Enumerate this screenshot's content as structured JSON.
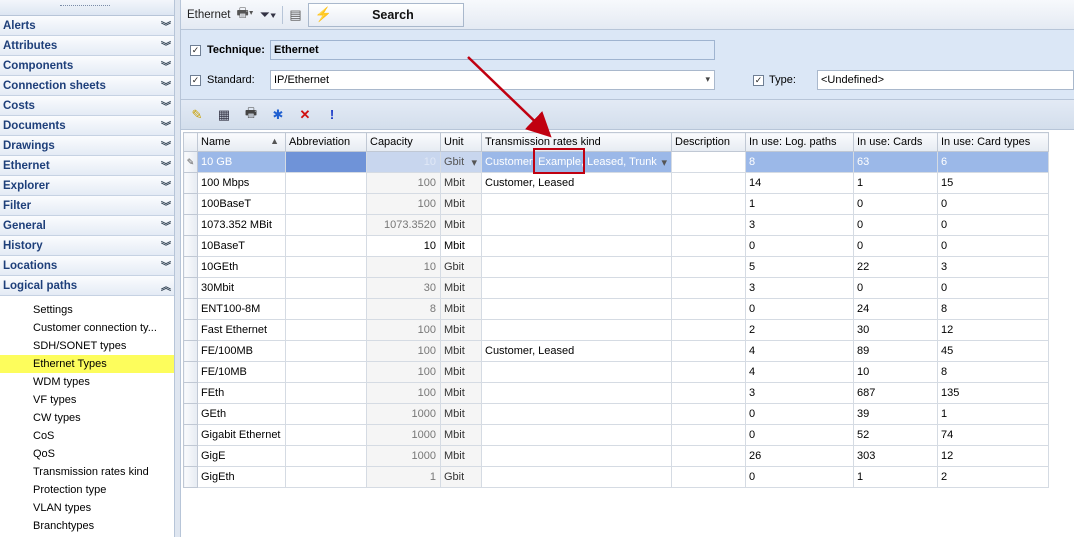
{
  "sidebar": {
    "sections": [
      {
        "label": "Alerts"
      },
      {
        "label": "Attributes"
      },
      {
        "label": "Components"
      },
      {
        "label": "Connection sheets"
      },
      {
        "label": "Costs"
      },
      {
        "label": "Documents"
      },
      {
        "label": "Drawings"
      },
      {
        "label": "Ethernet"
      },
      {
        "label": "Explorer"
      },
      {
        "label": "Filter"
      },
      {
        "label": "General"
      },
      {
        "label": "History"
      },
      {
        "label": "Locations"
      },
      {
        "label": "Logical paths"
      }
    ],
    "expanded_section": "Logical paths",
    "items": [
      {
        "label": "Settings"
      },
      {
        "label": "Customer connection ty..."
      },
      {
        "label": "SDH/SONET types"
      },
      {
        "label": "Ethernet Types"
      },
      {
        "label": "WDM types"
      },
      {
        "label": "VF types"
      },
      {
        "label": "CW types"
      },
      {
        "label": "CoS"
      },
      {
        "label": "QoS"
      },
      {
        "label": "Transmission rates kind"
      },
      {
        "label": "Protection type"
      },
      {
        "label": "VLAN types"
      },
      {
        "label": "Branchtypes"
      }
    ],
    "selected_item": "Ethernet Types"
  },
  "toolbar": {
    "tab_label": "Ethernet",
    "search_label": "Search"
  },
  "filters": {
    "technique_label": "Technique:",
    "technique_value": "Ethernet",
    "standard_label": "Standard:",
    "standard_value": "IP/Ethernet",
    "type_label": "Type:",
    "type_value": "<Undefined>"
  },
  "grid": {
    "columns": [
      "Name",
      "Abbreviation",
      "Capacity",
      "Unit",
      "Transmission rates kind",
      "Description",
      "In use: Log. paths",
      "In use: Cards",
      "In use: Card types"
    ],
    "rows": [
      {
        "name": "10 GB",
        "abbr": "",
        "capacity": "10",
        "unit": "Gbit",
        "trk": "Customer, Example, Leased, Trunk",
        "desc": "",
        "logpaths": "8",
        "cards": "63",
        "cardtypes": "6"
      },
      {
        "name": "100 Mbps",
        "abbr": "",
        "capacity": "100",
        "unit": "Mbit",
        "trk": "Customer, Leased",
        "desc": "",
        "logpaths": "14",
        "cards": "1",
        "cardtypes": "15"
      },
      {
        "name": "100BaseT",
        "abbr": "",
        "capacity": "100",
        "unit": "Mbit",
        "trk": "",
        "desc": "",
        "logpaths": "1",
        "cards": "0",
        "cardtypes": "0"
      },
      {
        "name": "1073.352 MBit",
        "abbr": "",
        "capacity": "1073.3520",
        "unit": "Mbit",
        "trk": "",
        "desc": "",
        "logpaths": "3",
        "cards": "0",
        "cardtypes": "0"
      },
      {
        "name": "10BaseT",
        "abbr": "",
        "capacity": "10",
        "unit": "Mbit",
        "trk": "",
        "desc": "",
        "logpaths": "0",
        "cards": "0",
        "cardtypes": "0"
      },
      {
        "name": "10GEth",
        "abbr": "",
        "capacity": "10",
        "unit": "Gbit",
        "trk": "",
        "desc": "",
        "logpaths": "5",
        "cards": "22",
        "cardtypes": "3"
      },
      {
        "name": "30Mbit",
        "abbr": "",
        "capacity": "30",
        "unit": "Mbit",
        "trk": "",
        "desc": "",
        "logpaths": "3",
        "cards": "0",
        "cardtypes": "0"
      },
      {
        "name": "ENT100-8M",
        "abbr": "",
        "capacity": "8",
        "unit": "Mbit",
        "trk": "",
        "desc": "",
        "logpaths": "0",
        "cards": "24",
        "cardtypes": "8"
      },
      {
        "name": "Fast Ethernet",
        "abbr": "",
        "capacity": "100",
        "unit": "Mbit",
        "trk": "",
        "desc": "",
        "logpaths": "2",
        "cards": "30",
        "cardtypes": "12"
      },
      {
        "name": "FE/100MB",
        "abbr": "",
        "capacity": "100",
        "unit": "Mbit",
        "trk": "Customer, Leased",
        "desc": "",
        "logpaths": "4",
        "cards": "89",
        "cardtypes": "45"
      },
      {
        "name": "FE/10MB",
        "abbr": "",
        "capacity": "100",
        "unit": "Mbit",
        "trk": "",
        "desc": "",
        "logpaths": "4",
        "cards": "10",
        "cardtypes": "8"
      },
      {
        "name": "FEth",
        "abbr": "",
        "capacity": "100",
        "unit": "Mbit",
        "trk": "",
        "desc": "",
        "logpaths": "3",
        "cards": "687",
        "cardtypes": "135"
      },
      {
        "name": "GEth",
        "abbr": "",
        "capacity": "1000",
        "unit": "Mbit",
        "trk": "",
        "desc": "",
        "logpaths": "0",
        "cards": "39",
        "cardtypes": "1"
      },
      {
        "name": "Gigabit Ethernet",
        "abbr": "",
        "capacity": "1000",
        "unit": "Mbit",
        "trk": "",
        "desc": "",
        "logpaths": "0",
        "cards": "52",
        "cardtypes": "74"
      },
      {
        "name": "GigE",
        "abbr": "",
        "capacity": "1000",
        "unit": "Mbit",
        "trk": "",
        "desc": "",
        "logpaths": "26",
        "cards": "303",
        "cardtypes": "12"
      },
      {
        "name": "GigEth",
        "abbr": "",
        "capacity": "1",
        "unit": "Gbit",
        "trk": "",
        "desc": "",
        "logpaths": "0",
        "cards": "1",
        "cardtypes": "2"
      }
    ],
    "bold_capacity_rows": [
      4
    ],
    "selected_row": 0
  },
  "colors": {
    "selection": "#9bb8e8",
    "sidebar_selected": "#fdfd5c",
    "annotation": "#c00010"
  }
}
